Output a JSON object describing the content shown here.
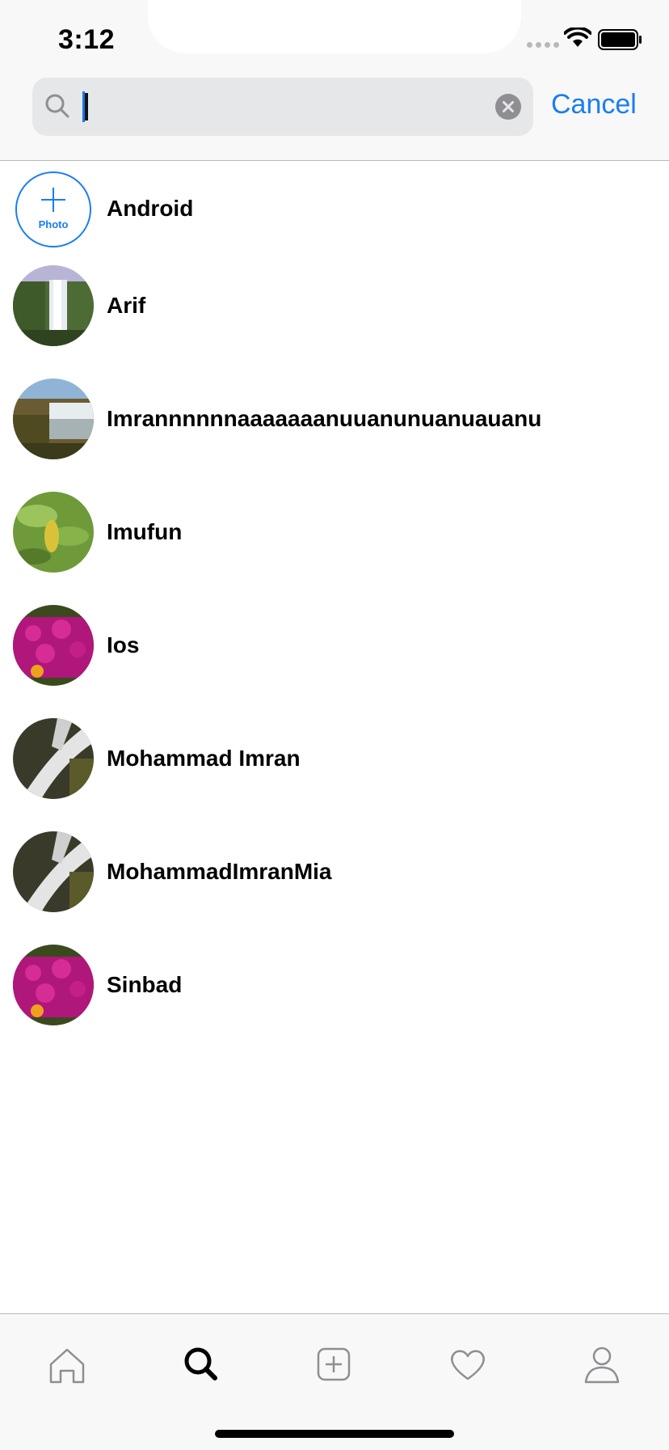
{
  "status_bar": {
    "time": "3:12"
  },
  "search": {
    "value": "I",
    "cancel_label": "Cancel"
  },
  "results": [
    {
      "name": "Android",
      "avatar": "add-photo",
      "photo_label": "Photo"
    },
    {
      "name": "Arif",
      "avatar": "waterfall-green"
    },
    {
      "name": "Imrannnnnnaaaaaaanuuanunuanuauanu",
      "avatar": "waterfall-river"
    },
    {
      "name": "Imufun",
      "avatar": "leaves"
    },
    {
      "name": "Ios",
      "avatar": "pink-flowers"
    },
    {
      "name": "Mohammad Imran",
      "avatar": "waterfall-rocks"
    },
    {
      "name": "MohammadImranMia",
      "avatar": "waterfall-rocks"
    },
    {
      "name": "Sinbad",
      "avatar": "pink-flowers"
    }
  ],
  "tab_bar": {
    "tabs": [
      {
        "icon": "home-icon",
        "selected": false
      },
      {
        "icon": "search-icon",
        "selected": true
      },
      {
        "icon": "add-post-icon",
        "selected": false
      },
      {
        "icon": "heart-icon",
        "selected": false
      },
      {
        "icon": "profile-icon",
        "selected": false
      }
    ]
  },
  "colors": {
    "accent": "#1a7df0",
    "tab_inactive": "#8e8e93"
  }
}
